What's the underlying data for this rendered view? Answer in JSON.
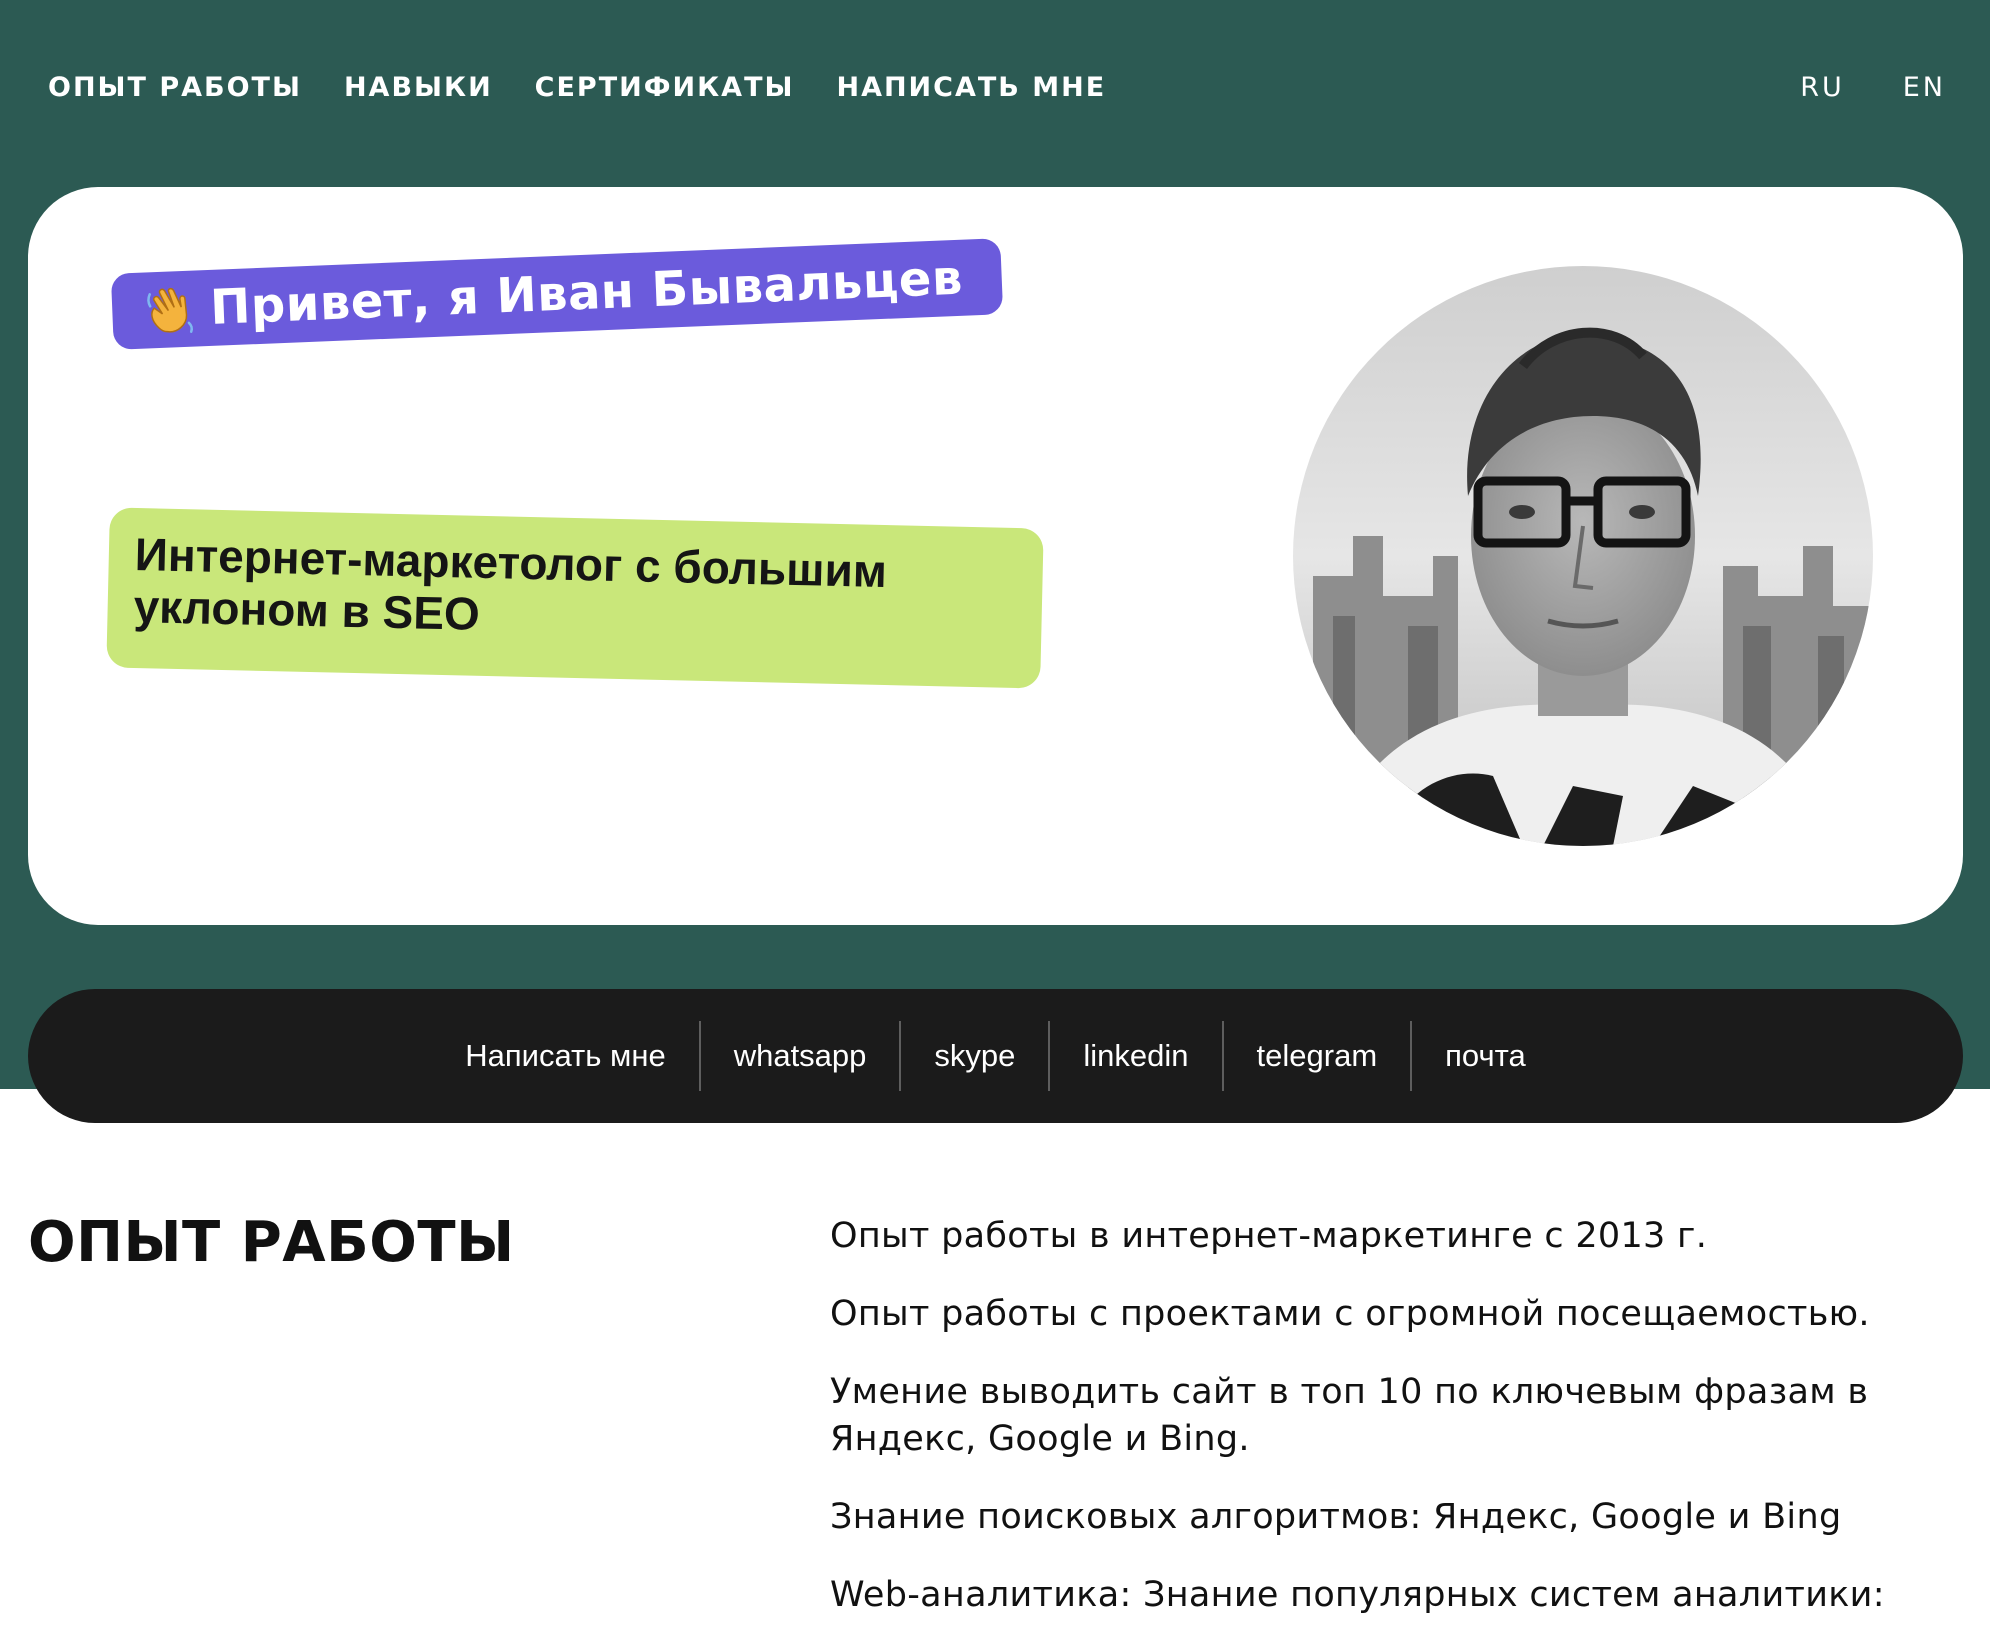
{
  "nav": {
    "items": [
      {
        "label": "ОПЫТ РАБОТЫ"
      },
      {
        "label": "НАВЫКИ"
      },
      {
        "label": "СЕРТИФИКАТЫ"
      },
      {
        "label": "НАПИСАТЬ МНЕ"
      }
    ],
    "languages": [
      "RU",
      "EN"
    ]
  },
  "hero": {
    "greeting": "Привет, я Иван Бывальцев",
    "greeting_icon": "waving-hand-icon",
    "role": "Интернет-маркетолог с большим уклоном в SEO",
    "avatar_image": "profile-photo"
  },
  "contacts": [
    {
      "label": "Написать мне"
    },
    {
      "label": "whatsapp"
    },
    {
      "label": "skype"
    },
    {
      "label": "linkedin"
    },
    {
      "label": "telegram"
    },
    {
      "label": "почта"
    }
  ],
  "experience": {
    "title": "ОПЫТ РАБОТЫ",
    "items": [
      "Опыт работы в интернет-маркетинге с 2013 г.",
      "Опыт работы с проектами с огромной посещаемостью.",
      "Умение выводить сайт в топ 10 по ключевым фразам в Яндекс, Google и Bing.",
      "Знание поисковых алгоритмов: Яндекс, Google и Bing",
      "Web-аналитика: Знание популярных систем аналитики:"
    ]
  },
  "colors": {
    "header_bg": "#2c5a53",
    "greeting_pill": "#6b5bdc",
    "role_pill": "#c9e77a",
    "contact_bar": "#1b1b1b"
  }
}
